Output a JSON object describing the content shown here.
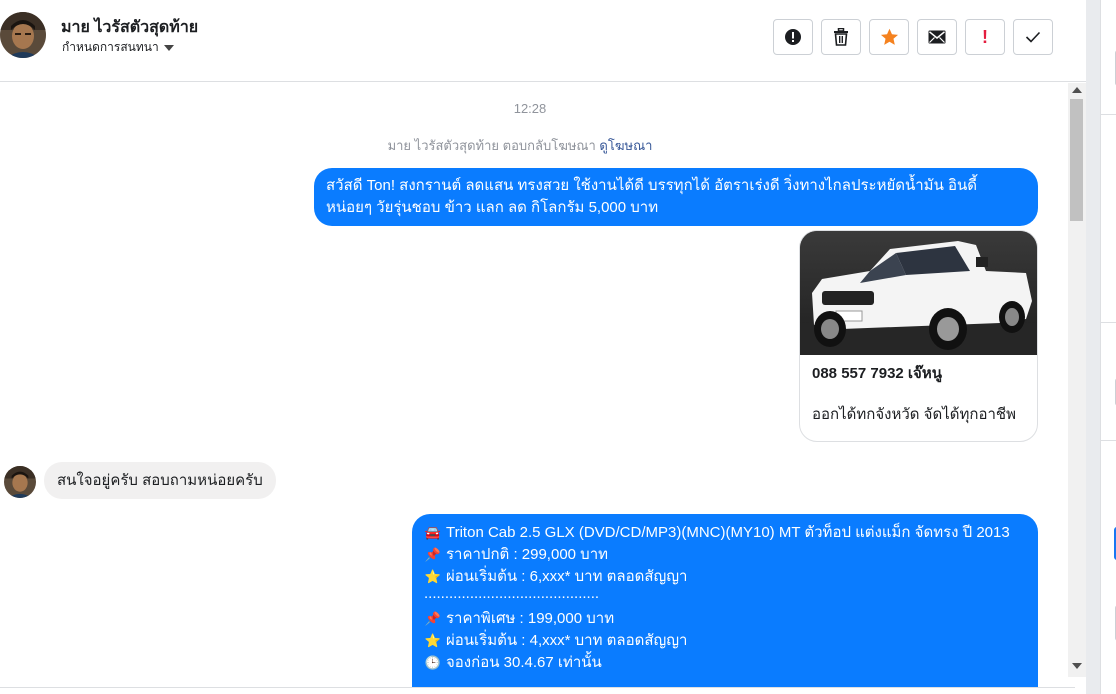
{
  "header": {
    "contact_name": "มาย ไวรัสตัวสุดท้าย",
    "settings_label": "กำหนดการสนทนา"
  },
  "toolbar": {
    "buttons": [
      {
        "icon": "alert-circle-icon",
        "name": "report-spam-button"
      },
      {
        "icon": "trash-icon",
        "name": "delete-button"
      },
      {
        "icon": "star-icon",
        "name": "star-button",
        "color": "#f5821f"
      },
      {
        "icon": "envelope-icon",
        "name": "mark-unread-button"
      },
      {
        "icon": "exclamation-icon",
        "name": "mark-important-button",
        "color": "#e41e3f",
        "label": "!"
      },
      {
        "icon": "check-icon",
        "name": "mark-done-button"
      }
    ]
  },
  "thread": {
    "timestamp": "12:28",
    "ad_reply_text": "มาย ไวรัสตัวสุดท้าย ตอบกลับโฆษณา",
    "ad_reply_link": "ดูโฆษณา",
    "message1": "สวัสดี Ton! สงกรานต์ ลดแสน ทรงสวย ใช้งานได้ดี บรรทุกได้ อัตราเร่งดี วิ่งทางไกลประหยัดน้ำมัน อินดี้ หน่อยๆ วัยรุ่นชอบ ข้าว แลก ลด กิโลกรัม 5,000 บาท",
    "ad_card": {
      "title": "088 557 7932 เจ๊หนู",
      "description": "ออกได้ทกจังหวัด จัดได้ทุกอาชีพ"
    },
    "incoming_message": "สนใจอยู่ครับ สอบถามหน่อยครับ",
    "message3": {
      "lines": [
        {
          "icon": "🚘",
          "text": "Triton Cab 2.5 GLX (DVD/CD/MP3)(MNC)(MY10) MT ตัวท็อป แต่งแม็ก จัดทรง ปี 2013"
        },
        {
          "icon": "📌",
          "text": "ราคาปกติ : 299,000 บาท"
        },
        {
          "icon": "⭐",
          "text": "ผ่อนเริ่มต้น : 6,xxx* บาท ตลอดสัญญา"
        },
        {
          "icon": "",
          "text": ".................................................."
        },
        {
          "icon": "📌",
          "text": "ราคาพิเศษ : 199,000 บาท"
        },
        {
          "icon": "⭐",
          "text": "ผ่อนเริ่มต้น : 4,xxx* บาท ตลอดสัญญา"
        },
        {
          "icon": "🕒",
          "text": "จองก่อน 30.4.67 เท่านั้น"
        }
      ]
    }
  },
  "colors": {
    "outgoing_bubble": "#0a7cff",
    "incoming_bubble": "#f1f0f0",
    "link": "#385898"
  }
}
